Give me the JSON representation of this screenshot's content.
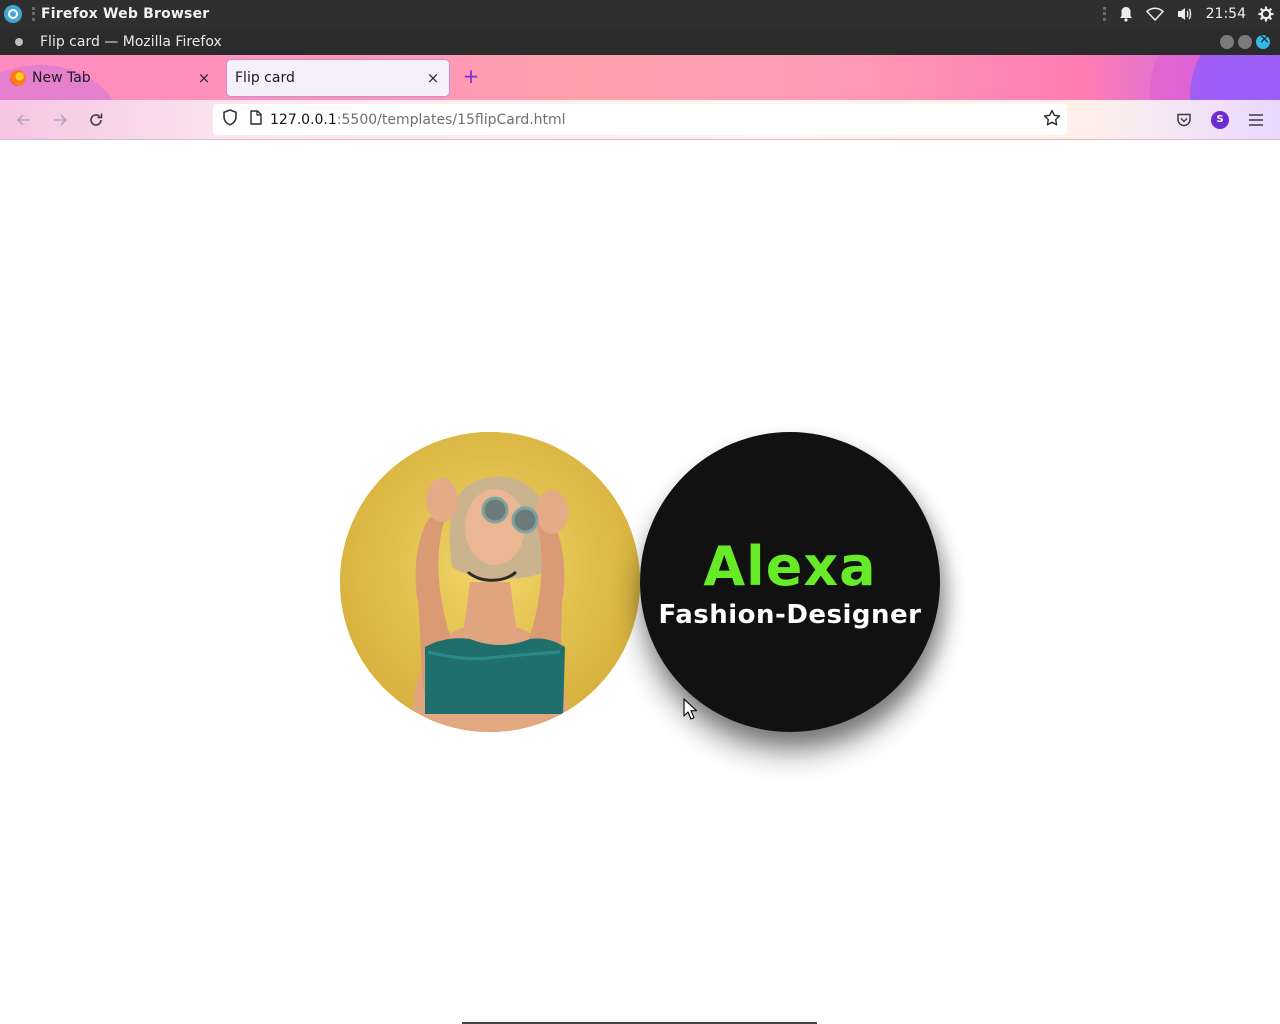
{
  "system_bar": {
    "app_name": "Firefox Web Browser",
    "clock": "21:54"
  },
  "window": {
    "title": "Flip card — Mozilla Firefox"
  },
  "tabs": [
    {
      "label": "New Tab",
      "active": false
    },
    {
      "label": "Flip card",
      "active": true
    }
  ],
  "address_bar": {
    "host": "127.0.0.1",
    "path": ":5500/templates/15flipCard.html"
  },
  "profile": {
    "initial": "S"
  },
  "card": {
    "name": "Alexa",
    "role": "Fashion-Designer",
    "name_color": "#67ea27",
    "back_color": "#111111"
  },
  "icons": {
    "tray": [
      "bell-icon",
      "wifi-icon",
      "volume-icon",
      "settings-icon"
    ],
    "nav": [
      "back-arrow-icon",
      "forward-arrow-icon",
      "reload-icon",
      "shield-icon",
      "page-icon",
      "bookmark-star-icon",
      "pocket-icon",
      "menu-icon"
    ]
  }
}
